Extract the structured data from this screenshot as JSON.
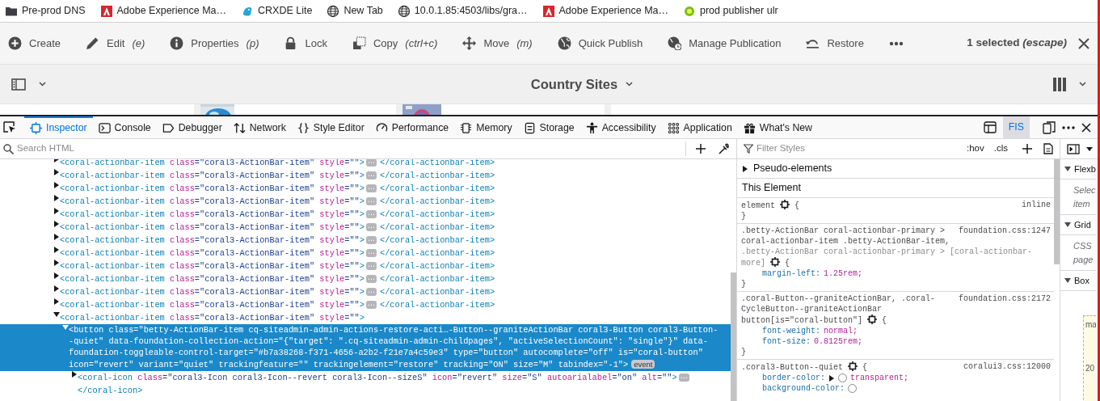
{
  "bookmarks": [
    {
      "kind": "folder",
      "label": "Pre-prod DNS"
    },
    {
      "kind": "adobe",
      "label": "Adobe Experience Ma…"
    },
    {
      "kind": "crx",
      "label": "CRXDE Lite"
    },
    {
      "kind": "globe",
      "label": "New Tab"
    },
    {
      "kind": "globe",
      "label": "10.0.1.85:4503/libs/gra…"
    },
    {
      "kind": "adobe",
      "label": "Adobe Experience Ma…"
    },
    {
      "kind": "dot",
      "label": "prod publisher ulr"
    }
  ],
  "action_bar": {
    "actions": [
      {
        "kind": "plus-circle",
        "label": "Create"
      },
      {
        "kind": "pencil",
        "label": "Edit",
        "shortcut": "(e)"
      },
      {
        "kind": "info",
        "label": "Properties",
        "shortcut": "(p)"
      },
      {
        "kind": "lock",
        "label": "Lock"
      },
      {
        "kind": "copy",
        "label": "Copy",
        "shortcut": "(ctrl+c)"
      },
      {
        "kind": "move",
        "label": "Move",
        "shortcut": "(m)"
      },
      {
        "kind": "globe-solid",
        "label": "Quick Publish"
      },
      {
        "kind": "globe-clock",
        "label": "Manage Publication"
      },
      {
        "kind": "restore",
        "label": "Restore"
      }
    ],
    "selection": "1 selected",
    "selection_shortcut": "(escape)"
  },
  "title_bar": {
    "title": "Country Sites"
  },
  "devtools": {
    "tabs": [
      {
        "kind": "inspector",
        "label": "Inspector",
        "selected": true
      },
      {
        "kind": "console",
        "label": "Console",
        "selected": false
      },
      {
        "kind": "debugger",
        "label": "Debugger",
        "selected": false
      },
      {
        "kind": "network",
        "label": "Network",
        "selected": false
      },
      {
        "kind": "braces",
        "label": "Style Editor",
        "selected": false
      },
      {
        "kind": "gauge",
        "label": "Performance",
        "selected": false
      },
      {
        "kind": "chip",
        "label": "Memory",
        "selected": false
      },
      {
        "kind": "storage",
        "label": "Storage",
        "selected": false
      },
      {
        "kind": "person",
        "label": "Accessibility",
        "selected": false
      },
      {
        "kind": "dots-grid",
        "label": "Application",
        "selected": false
      },
      {
        "kind": "gift",
        "label": "What's New",
        "selected": false
      }
    ],
    "fis": {
      "label": "FIS",
      "active": true
    },
    "search_placeholder": "Search HTML",
    "filter_placeholder": "Filter Styles",
    "hov": ":hov",
    "cls": ".cls"
  },
  "markup": [
    {
      "open": "<coral-actionbar-item",
      "attributes": [
        "class=\"coral3-ActionBar-item\"",
        "style=\"\""
      ],
      "end": ">",
      "badge": "⋯",
      "close": "</coral-actionbar-item>",
      "expanded": false,
      "selected": false
    },
    {
      "open": "<coral-actionbar-item",
      "attributes": [
        "class=\"coral3-ActionBar-item\"",
        "style=\"\""
      ],
      "end": ">",
      "badge": "⋯",
      "close": "</coral-actionbar-item>",
      "expanded": false,
      "selected": false
    },
    {
      "open": "<coral-actionbar-item",
      "attributes": [
        "class=\"coral3-ActionBar-item\"",
        "style=\"\""
      ],
      "end": ">",
      "badge": "⋯",
      "close": "</coral-actionbar-item>",
      "expanded": false,
      "selected": false
    },
    {
      "open": "<coral-actionbar-item",
      "attributes": [
        "class=\"coral3-ActionBar-item\"",
        "style=\"\""
      ],
      "end": ">",
      "badge": "⋯",
      "close": "</coral-actionbar-item>",
      "expanded": false,
      "selected": false
    },
    {
      "open": "<coral-actionbar-item",
      "attributes": [
        "class=\"coral3-ActionBar-item\"",
        "style=\"\""
      ],
      "end": ">",
      "badge": "⋯",
      "close": "</coral-actionbar-item>",
      "expanded": false,
      "selected": false
    },
    {
      "open": "<coral-actionbar-item",
      "attributes": [
        "class=\"coral3-ActionBar-item\"",
        "style=\"\""
      ],
      "end": ">",
      "badge": "⋯",
      "close": "</coral-actionbar-item>",
      "expanded": false,
      "selected": false
    },
    {
      "open": "<coral-actionbar-item",
      "attributes": [
        "class=\"coral3-ActionBar-item\"",
        "style=\"\""
      ],
      "end": ">",
      "badge": "⋯",
      "close": "</coral-actionbar-item>",
      "expanded": false,
      "selected": false
    },
    {
      "open": "<coral-actionbar-item",
      "attributes": [
        "class=\"coral3-ActionBar-item\"",
        "style=\"\""
      ],
      "end": ">",
      "badge": "⋯",
      "close": "</coral-actionbar-item>",
      "expanded": false,
      "selected": false
    },
    {
      "open": "<coral-actionbar-item",
      "attributes": [
        "class=\"coral3-ActionBar-item\"",
        "style=\"\""
      ],
      "end": ">",
      "badge": "⋯",
      "close": "</coral-actionbar-item>",
      "expanded": false,
      "selected": false
    },
    {
      "open": "<coral-actionbar-item",
      "attributes": [
        "class=\"coral3-ActionBar-item\"",
        "style=\"\""
      ],
      "end": ">",
      "badge": "⋯",
      "close": "</coral-actionbar-item>",
      "expanded": false,
      "selected": false
    },
    {
      "open": "<coral-actionbar-item",
      "attributes": [
        "class=\"coral3-ActionBar-item\"",
        "style=\"\""
      ],
      "end": ">",
      "badge": "⋯",
      "close": "</coral-actionbar-item>",
      "expanded": false,
      "selected": false
    },
    {
      "open": "<coral-actionbar-item",
      "attributes": [
        "class=\"coral3-ActionBar-item\"",
        "style=\"\""
      ],
      "end": ">",
      "badge": "⋯",
      "close": "</coral-actionbar-item>",
      "expanded": false,
      "selected": false
    },
    {
      "open": "<coral-actionbar-item",
      "attributes": [
        "class=\"coral3-ActionBar-item\"",
        "style=\"\""
      ],
      "end": ">",
      "expanded": true,
      "selected": false,
      "children": [
        {
          "open": "<button",
          "attributes": [
            "class=\"betty-ActionBar-item cq-siteadmin-admin-actions-restore-acti…-Button--graniteActionBar coral3-Button coral3-Button--quiet\"",
            "data-foundation-collection-action=\"{\"target\": \".cq-siteadmin-admin-childpages\", \"activeSelectionCount\": \"single\"}\"",
            "data-foundation-toggleable-control-target=\"#b7a38268-f371-4656-a2b2-f21e7a4c59e3\"",
            "type=\"button\"",
            "autocomplete=\"off\"",
            "is=\"coral-button\"",
            "icon=\"revert\"",
            "variant=\"quiet\"",
            "trackingfeature=\"\"",
            "trackingelement=\"restore\"",
            "tracking=\"ON\"",
            "size=\"M\"",
            "tabindex=\"-1\""
          ],
          "end": ">",
          "event_badge": "event",
          "expanded": true,
          "selected": true,
          "children": [
            {
              "open": "<coral-icon",
              "attributes": [
                "class=\"coral3-Icon coral3-Icon--revert coral3-Icon--sizeS\"",
                "icon=\"revert\"",
                "size=\"S\"",
                "autoarialabel=\"on\"",
                "alt=\"\""
              ],
              "end": ">",
              "badge": "⋯",
              "close": "</coral-icon>",
              "expanded": false,
              "selected": false
            }
          ]
        }
      ]
    }
  ],
  "rules": {
    "pseudo": "Pseudo-elements",
    "pseudo_expanded": false,
    "section": "This Element",
    "items": [
      {
        "selector": [
          {
            "text": "element",
            "matched": true
          }
        ],
        "source": "inline",
        "open_brace": "{",
        "close_brace": "}"
      },
      {
        "selector": [
          {
            "text": ".betty-ActionBar coral-actionbar-primary >",
            "matched": true
          },
          {
            "text": "coral-actionbar-item .betty-ActionBar-item,",
            "matched": true
          },
          {
            "text": ".betty-ActionBar coral-actionbar-primary > [coral-actionbar-",
            "matched": false
          },
          {
            "text": "more]",
            "matched": false
          }
        ],
        "source": "foundation.css:1247",
        "open_brace": "{",
        "close_brace": "}",
        "declarations": [
          {
            "property": "margin-left:",
            "value": "1.25rem;"
          }
        ]
      },
      {
        "selector": [
          {
            "text": ".coral-Button--graniteActionBar, .coral-",
            "matched": true
          },
          {
            "text": "CycleButton--graniteActionBar",
            "matched": true
          },
          {
            "text": "button[is=\"coral-button\"]",
            "matched": true
          }
        ],
        "source": "foundation.css:2172",
        "open_brace": "{",
        "close_brace": "}",
        "declarations": [
          {
            "property": "font-weight:",
            "value": "normal;"
          },
          {
            "property": "font-size:",
            "value": "0.8125rem;"
          }
        ]
      },
      {
        "selector": [
          {
            "text": ".coral3-Button--quiet",
            "matched": true
          }
        ],
        "source": "coralui3.css:12000",
        "open_brace": "{",
        "declarations": [
          {
            "property": "border-color:",
            "value": "transparent;",
            "swatch": true,
            "expandable": true
          },
          {
            "property": "background-color:",
            "swatch": true
          }
        ]
      }
    ]
  },
  "layout_panel": {
    "sections": [
      {
        "title": "Flexb",
        "expanded": true,
        "hint": "Selec item"
      },
      {
        "title": "Grid",
        "expanded": true,
        "hint": "CSS page"
      },
      {
        "title": "Box",
        "expanded": true,
        "box_model": [
          "ma",
          "20"
        ]
      }
    ]
  }
}
